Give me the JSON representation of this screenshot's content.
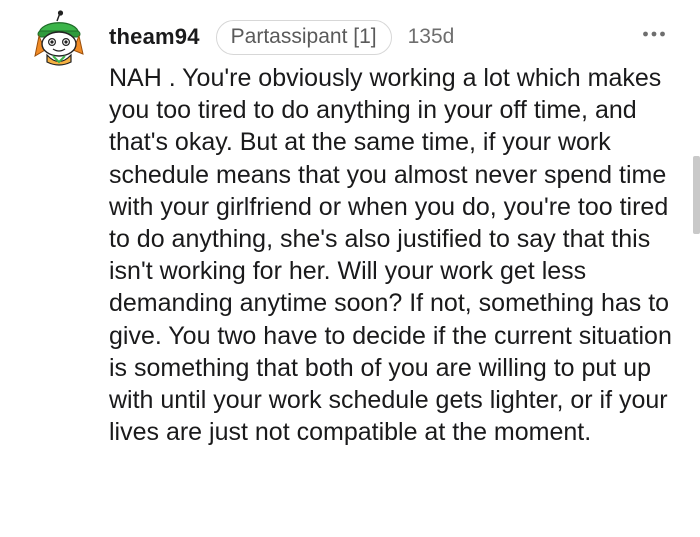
{
  "comment": {
    "username": "theam94",
    "flair": "Partassipant [1]",
    "age": "135d",
    "more_icon": "more-horizontal-icon",
    "avatar_icon": "snoo-avatar-icon",
    "body": "NAH . You're obviously working a lot which makes you too tired to do anything in your off time, and that's okay. But at the same time, if your work schedule means that you almost never spend time with your girlfriend or when you do, you're too tired to do anything, she's also justified to say that this isn't working for her. Will your work get less demanding anytime soon? If not, something has to give. You two have to decide if the current situation is something that both of you are willing to put up with until your work schedule gets lighter, or if your lives are just not compatible at the moment."
  },
  "colors": {
    "text": "#1a1a1b",
    "meta": "#6e6e6e",
    "flair_border": "#d7d7d7",
    "avatar_green": "#3cb44a",
    "avatar_orange": "#f08a24"
  }
}
